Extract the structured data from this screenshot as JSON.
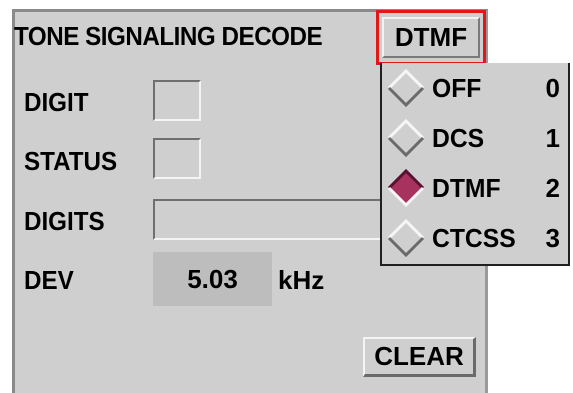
{
  "panel": {
    "title": "TONE SIGNALING DECODE",
    "mode_button_label": "DTMF"
  },
  "fields": {
    "digit_label": "DIGIT",
    "status_label": "STATUS",
    "digits_label": "DIGITS",
    "dev_label": "DEV",
    "dev_value": "5.03",
    "dev_unit": "kHz"
  },
  "clear_button_label": "CLEAR",
  "mode_menu": {
    "selected": "DTMF",
    "items": [
      {
        "label": "OFF",
        "index": "0",
        "selected": false,
        "icon": "diamond-radio-icon"
      },
      {
        "label": "DCS",
        "index": "1",
        "selected": false,
        "icon": "diamond-radio-icon"
      },
      {
        "label": "DTMF",
        "index": "2",
        "selected": true,
        "icon": "diamond-radio-selected-icon"
      },
      {
        "label": "CTCSS",
        "index": "3",
        "selected": false,
        "icon": "diamond-radio-icon"
      }
    ]
  },
  "colors": {
    "panel_bg": "#cfcfcf",
    "focus_border": "#e01818",
    "selected_radio": "#a8325e"
  }
}
